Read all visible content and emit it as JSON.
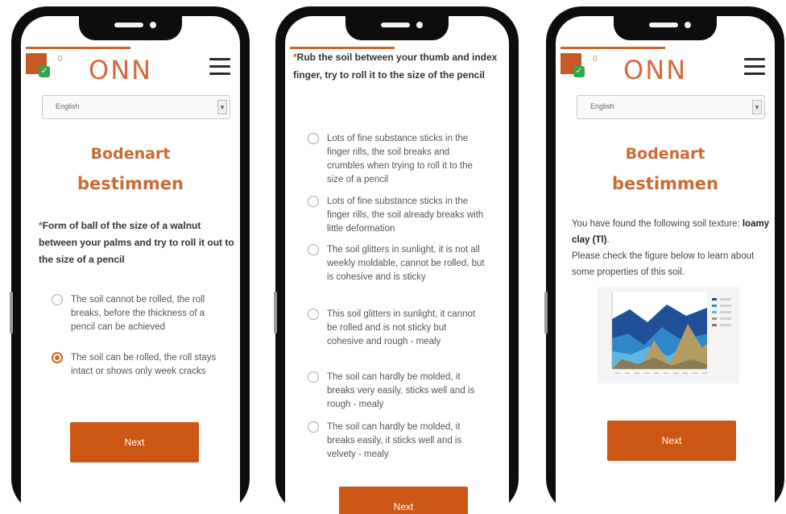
{
  "brand": {
    "name": "ONN",
    "counter": "0"
  },
  "language": {
    "selected": "English"
  },
  "screen1": {
    "title_line1": "Bodenart",
    "title_line2": "bestimmen",
    "question_star": "*",
    "question": "Form of ball of the size of a walnut between your palms and try to roll it out to the size of a pencil",
    "options": [
      {
        "text": "The soil cannot be rolled, the roll breaks, before the thickness of a pencil can be achieved",
        "selected": false
      },
      {
        "text": "The soil can be rolled, the roll stays intact or shows only week cracks",
        "selected": true
      }
    ],
    "next_label": "Next"
  },
  "screen2": {
    "question_star": "*",
    "question": "Rub the soil between your thumb and index finger, try to roll it to the size of the pencil",
    "options": [
      {
        "text": "Lots of fine substance sticks in the finger rills, the soil breaks and crumbles when trying to roll it to the size of a pencil",
        "selected": false
      },
      {
        "text": "Lots of fine substance sticks in the finger rills, the soil already breaks with little deformation",
        "selected": false
      },
      {
        "text": "The soil glitters in sunlight, it is not all weekly moldable, cannot be rolled, but is cohesive and is sticky",
        "selected": false
      },
      {
        "text": "This soil glitters in sunlight, it cannot be rolled and is not sticky but cohesive and rough - mealy",
        "selected": false
      },
      {
        "text": "The soil can hardly be molded, it breaks very easily, sticks well and is rough - mealy",
        "selected": false
      },
      {
        "text": "The soil can hardly be molded, it breaks easily, it sticks well and is velvety - mealy",
        "selected": false
      }
    ],
    "next_label": "Next"
  },
  "screen3": {
    "title_line1": "Bodenart",
    "title_line2": "bestimmen",
    "result_prefix": "You have found the following soil texture: ",
    "result_value": "loamy clay (Tl)",
    "result_suffix": ".",
    "hint": "Please check the figure below to learn about some properties of this soil.",
    "next_label": "Next"
  },
  "colors": {
    "accent": "#cc5714",
    "title": "#cc6a33",
    "logo": "#d9693a",
    "check": "#2fa84a"
  },
  "icons": [
    "hamburger-menu-icon",
    "checkmark-icon",
    "chevron-down-icon",
    "radio-icon"
  ]
}
